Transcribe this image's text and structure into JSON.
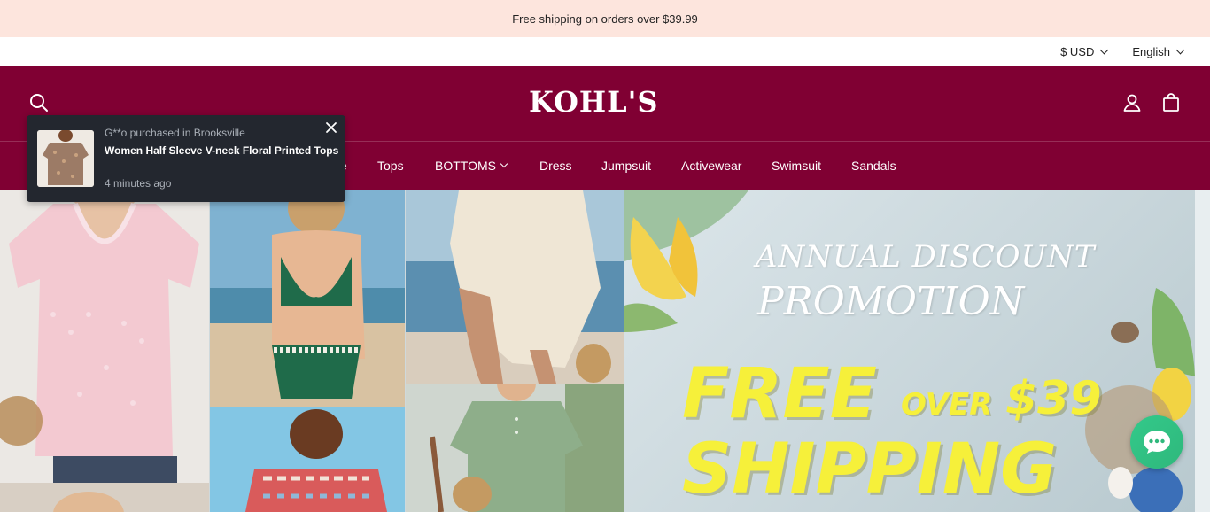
{
  "announcement": {
    "text": "Free shipping on orders over $39.99"
  },
  "topbar": {
    "currency": "$ USD",
    "language": "English"
  },
  "header": {
    "logo_text": "KOHL'S",
    "brand_color": "#800033"
  },
  "icons": {
    "search": "search-icon",
    "account": "user-icon",
    "cart": "shopping-bag-icon",
    "close": "close-icon",
    "chat": "chat-bubble-icon",
    "chevron": "chevron-down-icon"
  },
  "nav": {
    "items": [
      {
        "label": "e"
      },
      {
        "label": "Tops"
      },
      {
        "label": "BOTTOMS"
      },
      {
        "label": "Dress"
      },
      {
        "label": "Jumpsuit"
      },
      {
        "label": "Activewear"
      },
      {
        "label": "Swimsuit"
      },
      {
        "label": "Sandals"
      }
    ]
  },
  "popup": {
    "who": "G**o purchased in Brooksville",
    "product": "Women Half Sleeve V-neck Floral Printed Tops",
    "time_ago": "4 minutes ago"
  },
  "banner": {
    "line1": "ANNUAL DISCOUNT",
    "line2": "PROMOTION",
    "free": "FREE",
    "over": "OVER",
    "amount": "$39",
    "shipping": "SHIPPING"
  }
}
